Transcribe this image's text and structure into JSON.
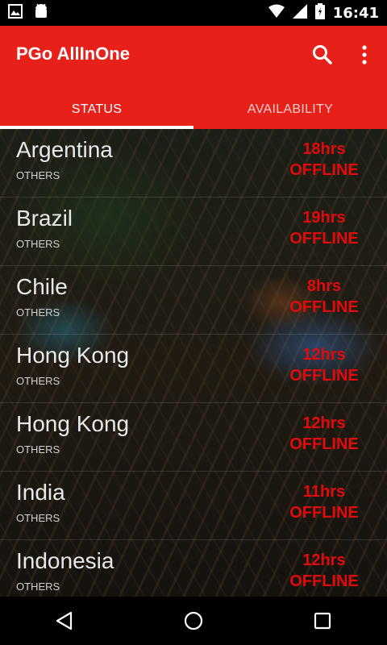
{
  "status_bar": {
    "time": "16:41",
    "icons": [
      "image-icon",
      "android-icon",
      "wifi-icon",
      "signal-icon",
      "battery-icon"
    ]
  },
  "app_bar": {
    "title": "PGo AllInOne",
    "tabs": [
      {
        "label": "STATUS",
        "active": true
      },
      {
        "label": "AVAILABILITY",
        "active": false
      }
    ],
    "accent_color": "#e8201a"
  },
  "servers": [
    {
      "country": "Argentina",
      "region": "OTHERS",
      "hours": "18hrs",
      "status": "OFFLINE"
    },
    {
      "country": "Brazil",
      "region": "OTHERS",
      "hours": "19hrs",
      "status": "OFFLINE"
    },
    {
      "country": "Chile",
      "region": "OTHERS",
      "hours": "8hrs",
      "status": "OFFLINE"
    },
    {
      "country": "Hong Kong",
      "region": "OTHERS",
      "hours": "12hrs",
      "status": "OFFLINE"
    },
    {
      "country": "Hong Kong",
      "region": "OTHERS",
      "hours": "12hrs",
      "status": "OFFLINE"
    },
    {
      "country": "India",
      "region": "OTHERS",
      "hours": "11hrs",
      "status": "OFFLINE"
    },
    {
      "country": "Indonesia",
      "region": "OTHERS",
      "hours": "12hrs",
      "status": "OFFLINE"
    }
  ],
  "status_color": "#e20a0a",
  "nav_bar": {
    "buttons": [
      "back-icon",
      "home-icon",
      "recents-icon"
    ]
  }
}
